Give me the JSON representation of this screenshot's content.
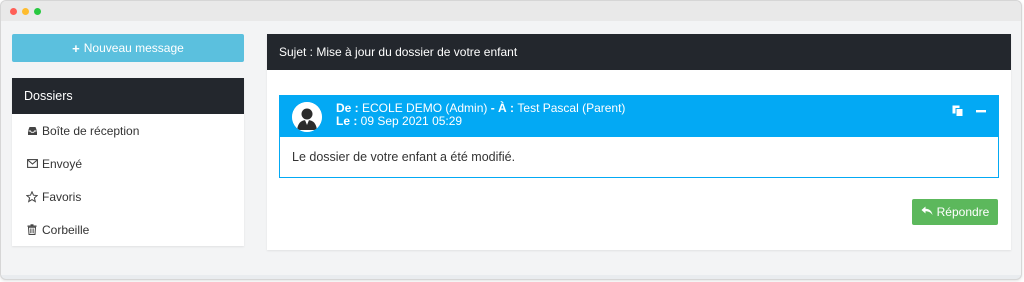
{
  "sidebar": {
    "new_message": "Nouveau message",
    "folders_title": "Dossiers",
    "items": [
      {
        "label": "Boîte de réception",
        "icon": "inbox-icon"
      },
      {
        "label": "Envoyé",
        "icon": "envelope-icon"
      },
      {
        "label": "Favoris",
        "icon": "star-icon"
      },
      {
        "label": "Corbeille",
        "icon": "trash-icon"
      }
    ]
  },
  "subject": {
    "label": "Sujet : ",
    "text": "Mise à jour du dossier de votre enfant"
  },
  "message": {
    "from_label": "De : ",
    "from": "ECOLE DEMO (Admin)",
    "to_sep": " - ",
    "to_label": "À : ",
    "to": "Test Pascal (Parent)",
    "date_label": "Le : ",
    "date": "09 Sep 2021 05:29",
    "body": "Le dossier de votre enfant a été modifié."
  },
  "actions": {
    "reply": "Répondre"
  },
  "colors": {
    "accent": "#03a9f4",
    "info_button": "#5bc0de",
    "success_button": "#5cb85c",
    "header_dark": "#23272d"
  }
}
